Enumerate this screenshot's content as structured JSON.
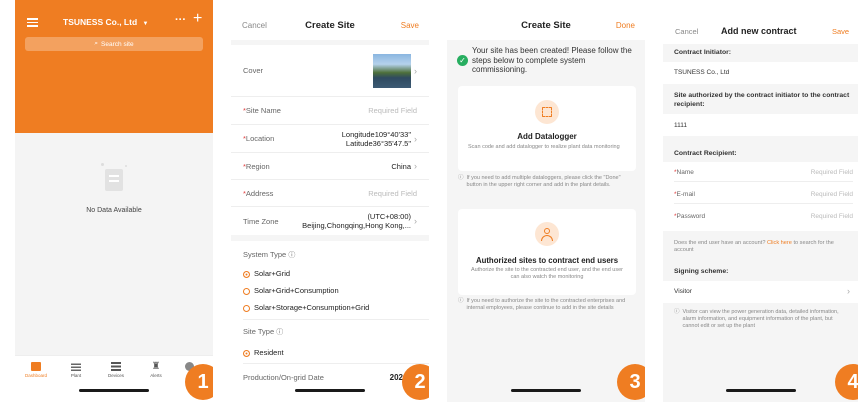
{
  "s1": {
    "company": "TSUNESS Co., Ltd",
    "search_placeholder": "Search site",
    "empty": "No Data Available",
    "tabs": [
      {
        "label": "Dashboard"
      },
      {
        "label": "Plant"
      },
      {
        "label": "Devices"
      },
      {
        "label": "Alerts"
      }
    ],
    "badge": "1"
  },
  "s2": {
    "cancel": "Cancel",
    "title": "Create Site",
    "save": "Save",
    "cover": "Cover",
    "site_name": "Site Name",
    "site_name_ph": "Required Field",
    "location": "Location",
    "location_v1": "Longitude109°40'33\"",
    "location_v2": "Latitude36°35'47.5\"",
    "region": "Region",
    "region_v": "China",
    "address": "Address",
    "address_ph": "Required Field",
    "tz": "Time Zone",
    "tz_v1": "(UTC+08:00)",
    "tz_v2": "Beijing,Chongqing,Hong Kong,...",
    "system_type": "System Type",
    "opt1": "Solar+Grid",
    "opt2": "Solar+Grid+Consumption",
    "opt3": "Solar+Storage+Consumption+Grid",
    "site_type": "Site Type",
    "resident": "Resident",
    "prod_date": "Production/On-grid Date",
    "prod_date_v": "2024-03",
    "badge": "2"
  },
  "s3": {
    "title": "Create Site",
    "done": "Done",
    "msg": "Your site has been created! Please follow the steps below to complete system commissioning.",
    "card1_title": "Add Datalogger",
    "card1_desc": "Scan code and add datalogger to realize plant data monitoring",
    "note1": "If you need to add multiple dataloggers, please click the \"Done\" button in the upper right corner and add in the plant details.",
    "card2_title": "Authorized sites to contract end users",
    "card2_desc": "Authorize the site to the contracted end user, and the end user can also watch the monitoring",
    "note2": "If you need to authorize the site to the contracted enterprises and internal employees, please continue to add in the site details",
    "badge": "3"
  },
  "s4": {
    "cancel": "Cancel",
    "title": "Add new contract",
    "save": "Save",
    "initiator_label": "Contract Initiator:",
    "initiator_value": "TSUNESS Co., Ltd",
    "authorized_label": "Site authorized by the contract initiator to the contract recipient:",
    "authorized_value": "1111",
    "recipient_label": "Contract Recipient:",
    "name": "Name",
    "email": "E-mail",
    "password": "Password",
    "required": "Required Field",
    "account_q": "Does the end user have an account?",
    "click_here": "Click here",
    "account_q2": "to search for the account",
    "signing": "Signing scheme:",
    "visitor": "Visitor",
    "visitor_note": "Visitor can view the power generation data, detailed information, alarm information, and equipment information of the plant, but cannot edit or set up the plant",
    "badge": "4"
  }
}
